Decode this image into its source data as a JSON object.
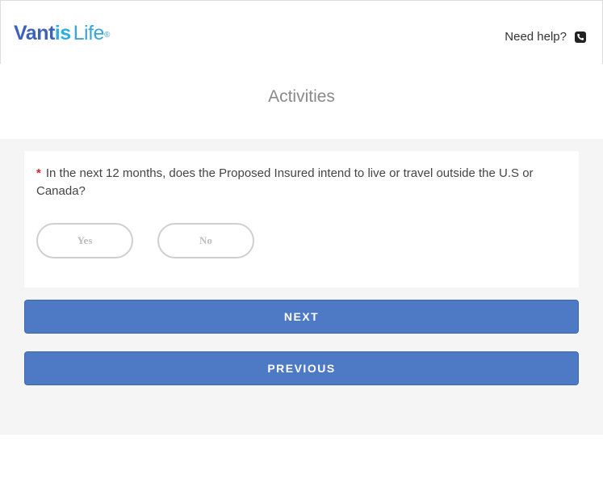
{
  "header": {
    "logo": {
      "part1": "Vant",
      "part2": "is",
      "part3": "Life",
      "reg": "®"
    },
    "help_text": "Need help?",
    "help_icon": "phone-icon"
  },
  "page": {
    "title": "Activities"
  },
  "question": {
    "required_mark": "*",
    "text": "In the next 12 months, does the Proposed Insured intend to live or travel outside the U.S or Canada?",
    "options": [
      "Yes",
      "No"
    ]
  },
  "buttons": {
    "next": "NEXT",
    "previous": "PREVIOUS"
  },
  "colors": {
    "brand_blue": "#3d63b8",
    "brand_light_blue": "#2aaee0",
    "button_blue": "#4e79c5",
    "required_red": "#d0272a",
    "content_bg": "#f5f5f5"
  }
}
